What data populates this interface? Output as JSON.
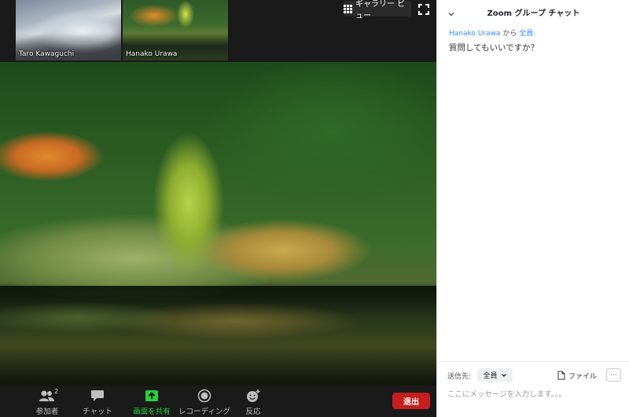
{
  "thumbnails": [
    {
      "name": "Taro Kawaguchi"
    },
    {
      "name": "Hanako Urawa"
    }
  ],
  "view_controls": {
    "gallery_label": "ギャラリー ビュー",
    "gallery_icon": "grid-icon",
    "fullscreen_icon": "fullscreen-icon"
  },
  "toolbar": {
    "participants": {
      "label": "参加者",
      "count": "2",
      "icon": "participants-icon"
    },
    "chat": {
      "label": "チャット",
      "icon": "chat-icon"
    },
    "share": {
      "label": "画面を共有",
      "icon": "share-screen-icon",
      "color": "#2ecc40"
    },
    "record": {
      "label": "レコーディング",
      "icon": "record-icon"
    },
    "reactions": {
      "label": "反応",
      "icon": "reaction-icon"
    },
    "leave": {
      "label": "退出",
      "color": "#c41e1e"
    }
  },
  "chat": {
    "title": "Zoom グループ チャット",
    "messages": [
      {
        "sender": "Hanako Urawa",
        "connector": "から",
        "recipient": "全員:",
        "text": "質問してもいいですか？"
      }
    ],
    "send_to_label": "送信先:",
    "recipient_value": "全員",
    "file_label": "ファイル",
    "more_label": "···",
    "input_placeholder": "ここにメッセージを入力します。。。",
    "accent_color": "#2d8cff"
  }
}
